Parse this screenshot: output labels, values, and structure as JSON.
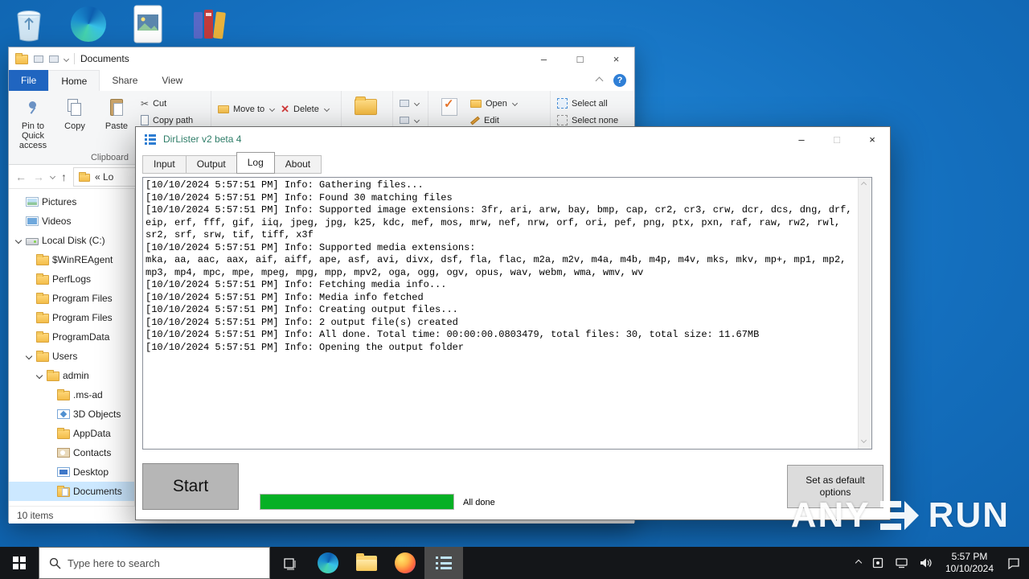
{
  "colors": {
    "accent_blue": "#2065c0",
    "progress_green": "#06b025",
    "selection_blue": "#cce8ff",
    "dirlister_title_color": "#2e7d68",
    "taskbar_black": "#141619",
    "desktop_blue": "#146fbe"
  },
  "desktop": {
    "icons": [
      "recycle-bin-icon",
      "edge-icon",
      "image-file-icon",
      "winrar-icon"
    ]
  },
  "explorer": {
    "title": "Documents",
    "tabs": [
      "File",
      "Home",
      "Share",
      "View"
    ],
    "active_tab": "Home",
    "ribbon": {
      "pin_label": "Pin to Quick access",
      "copy_label": "Copy",
      "paste_label": "Paste",
      "cut_label": "Cut",
      "copy_path_label": "Copy path",
      "move_to_label": "Move to",
      "delete_label": "Delete",
      "open_label": "Open",
      "edit_label": "Edit",
      "select_all_label": "Select all",
      "select_none_label": "Select none",
      "clipboard_group_label": "Clipboard"
    },
    "address_text": "« Lo",
    "sidebar": [
      {
        "label": "Pictures",
        "icon": "pictures",
        "indent": 1,
        "expanded": false,
        "selected": false
      },
      {
        "label": "Videos",
        "icon": "videos",
        "indent": 1,
        "expanded": false,
        "selected": false
      },
      {
        "label": "Local Disk (C:)",
        "icon": "drive",
        "indent": 1,
        "expanded": true,
        "selected": false
      },
      {
        "label": "$WinREAgent",
        "icon": "folder",
        "indent": 2,
        "expanded": false,
        "selected": false
      },
      {
        "label": "PerfLogs",
        "icon": "folder",
        "indent": 2,
        "expanded": false,
        "selected": false
      },
      {
        "label": "Program Files",
        "icon": "folder",
        "indent": 2,
        "expanded": false,
        "selected": false
      },
      {
        "label": "Program Files",
        "icon": "folder",
        "indent": 2,
        "expanded": false,
        "selected": false
      },
      {
        "label": "ProgramData",
        "icon": "folder",
        "indent": 2,
        "expanded": false,
        "selected": false
      },
      {
        "label": "Users",
        "icon": "folder",
        "indent": 2,
        "expanded": true,
        "selected": false
      },
      {
        "label": "admin",
        "icon": "folder",
        "indent": 3,
        "expanded": true,
        "selected": false
      },
      {
        "label": ".ms-ad",
        "icon": "folder",
        "indent": 4,
        "expanded": false,
        "selected": false
      },
      {
        "label": "3D Objects",
        "icon": "objects3d",
        "indent": 4,
        "expanded": false,
        "selected": false
      },
      {
        "label": "AppData",
        "icon": "folder",
        "indent": 4,
        "expanded": false,
        "selected": false
      },
      {
        "label": "Contacts",
        "icon": "contacts",
        "indent": 4,
        "expanded": false,
        "selected": false
      },
      {
        "label": "Desktop",
        "icon": "desktopicon",
        "indent": 4,
        "expanded": false,
        "selected": false
      },
      {
        "label": "Documents",
        "icon": "documents",
        "indent": 4,
        "expanded": false,
        "selected": true
      }
    ],
    "status_text": "10 items"
  },
  "dirlister": {
    "title": "DirLister v2 beta 4",
    "tabs": [
      "Input",
      "Output",
      "Log",
      "About"
    ],
    "active_tab": "Log",
    "log_lines": [
      "[10/10/2024 5:57:51 PM] Info: Gathering files...",
      "[10/10/2024 5:57:51 PM] Info: Found 30 matching files",
      "[10/10/2024 5:57:51 PM] Info: Supported image extensions: 3fr, ari, arw, bay, bmp, cap, cr2, cr3, crw, dcr, dcs, dng, drf, eip, erf, fff, gif, iiq, jpeg, jpg, k25, kdc, mef, mos, mrw, nef, nrw, orf, ori, pef, png, ptx, pxn, raf, raw, rw2, rwl, sr2, srf, srw, tif, tiff, x3f",
      "[10/10/2024 5:57:51 PM] Info: Supported media extensions:",
      "mka, aa, aac, aax, aif, aiff, ape, asf, avi, divx, dsf, fla, flac, m2a, m2v, m4a, m4b, m4p, m4v, mks, mkv, mp+, mp1, mp2, mp3, mp4, mpc, mpe, mpeg, mpg, mpp, mpv2, oga, ogg, ogv, opus, wav, webm, wma, wmv, wv",
      "[10/10/2024 5:57:51 PM] Info: Fetching media info...",
      "[10/10/2024 5:57:51 PM] Info: Media info fetched",
      "[10/10/2024 5:57:51 PM] Info: Creating output files...",
      "[10/10/2024 5:57:51 PM] Info: 2 output file(s) created",
      "[10/10/2024 5:57:51 PM] Info: All done. Total time: 00:00:00.0803479, total files: 30, total size: 11.67MB",
      "[10/10/2024 5:57:51 PM] Info: Opening the output folder"
    ],
    "start_label": "Start",
    "progress": {
      "value": 100,
      "label": "All done"
    },
    "default_label": "Set as default options"
  },
  "taskbar": {
    "search_placeholder": "Type here to search",
    "time": "5:57 PM",
    "date": "10/10/2024"
  },
  "watermark": {
    "left": "ANY",
    "right": "RUN"
  }
}
